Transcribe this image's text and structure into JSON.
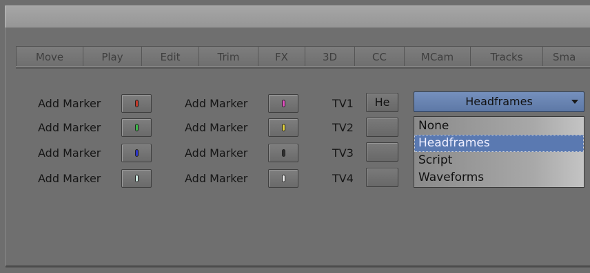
{
  "tabs": [
    "Move",
    "Play",
    "Edit",
    "Trim",
    "FX",
    "3D",
    "CC",
    "MCam",
    "Tracks",
    "Sma"
  ],
  "markers": {
    "label": "Add Marker",
    "left_colors": [
      "#c23a2a",
      "#3eb84a",
      "#2d36c8",
      "#cde8e0"
    ],
    "right_colors": [
      "#e050c0",
      "#e0d040",
      "#303030",
      "#e8e8e8"
    ]
  },
  "tv": {
    "labels": [
      "TV1",
      "TV2",
      "TV3",
      "TV4"
    ],
    "buttons": [
      "He",
      "",
      "",
      ""
    ]
  },
  "select": {
    "value": "Headframes",
    "options": [
      "None",
      "Headframes",
      "Script",
      "Waveforms"
    ],
    "selected_index": 1
  }
}
